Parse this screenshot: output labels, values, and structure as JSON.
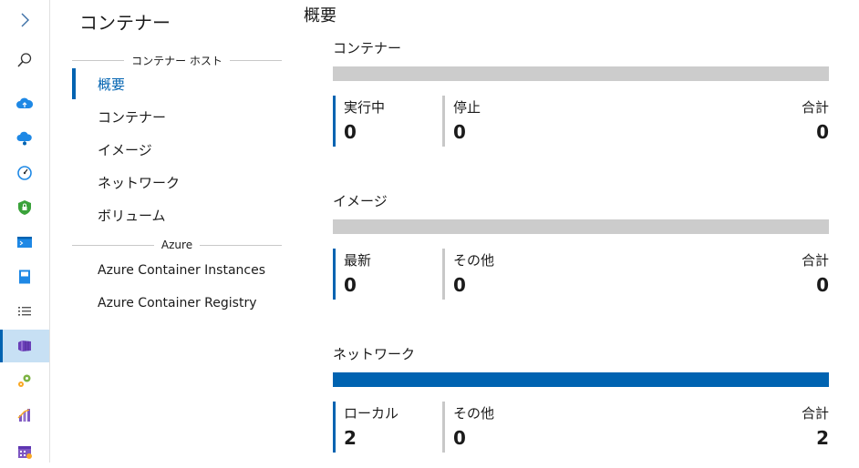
{
  "colors": {
    "accent": "#0063b1",
    "bar_empty": "#cccccc",
    "bar_filled": "#0063b1",
    "active_rail_bg": "#c7e0f4"
  },
  "rail": {
    "icons": [
      "expand-chevron-icon",
      "search-icon",
      "cloud-upload-icon",
      "cloud-network-icon",
      "performance-gauge-icon",
      "security-shield-icon",
      "terminal-icon",
      "book-icon",
      "list-icon",
      "containers-icon",
      "settings-gears-icon",
      "bar-chart-icon",
      "calendar-icon"
    ]
  },
  "subnav": {
    "title": "コンテナー",
    "group1_header": "コンテナー ホスト",
    "group1_items": [
      "概要",
      "コンテナー",
      "イメージ",
      "ネットワーク",
      "ボリューム"
    ],
    "group2_header": "Azure",
    "group2_items": [
      "Azure Container Instances",
      "Azure Container Registry"
    ]
  },
  "main": {
    "page_title": "概要",
    "sections": [
      {
        "title": "コンテナー",
        "bar_fill": 0,
        "stats": [
          {
            "label": "実行中",
            "value": "0"
          },
          {
            "label": "停止",
            "value": "0"
          },
          {
            "label": "合計",
            "value": "0"
          }
        ]
      },
      {
        "title": "イメージ",
        "bar_fill": 0,
        "stats": [
          {
            "label": "最新",
            "value": "0"
          },
          {
            "label": "その他",
            "value": "0"
          },
          {
            "label": "合計",
            "value": "0"
          }
        ]
      },
      {
        "title": "ネットワーク",
        "bar_fill": 1,
        "stats": [
          {
            "label": "ローカル",
            "value": "2"
          },
          {
            "label": "その他",
            "value": "0"
          },
          {
            "label": "合計",
            "value": "2"
          }
        ]
      }
    ]
  }
}
